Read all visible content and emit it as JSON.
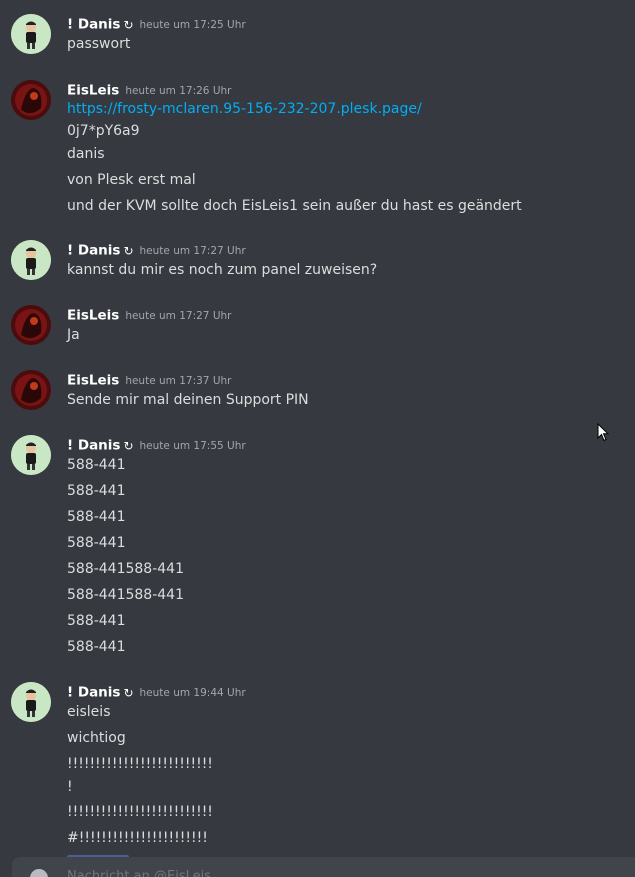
{
  "users": {
    "danis": {
      "name": "! Danis",
      "status_icon": "refresh-icon"
    },
    "eis": {
      "name": "EisLeis"
    }
  },
  "messages": [
    {
      "author": "! Danis",
      "time": "heute um 17:25 Uhr",
      "lines": [
        "passwort"
      ]
    },
    {
      "author": "EisLeis",
      "time": "heute um 17:26 Uhr",
      "link": "https://frosty-mclaren.95-156-232-207.plesk.page/",
      "lines": [
        "0j7*pY6a9",
        "danis",
        "von Plesk erst mal",
        "und der KVM sollte doch EisLeis1 sein außer du hast es geändert"
      ]
    },
    {
      "author": "! Danis",
      "time": "heute um 17:27 Uhr",
      "lines": [
        "kannst du mir es noch zum panel zuweisen?"
      ]
    },
    {
      "author": "EisLeis",
      "time": "heute um 17:27 Uhr",
      "lines": [
        "Ja"
      ]
    },
    {
      "author": "EisLeis",
      "time": "heute um 17:37 Uhr",
      "lines": [
        "Sende mir mal deinen Support PIN"
      ]
    },
    {
      "author": "! Danis",
      "time": "heute um 17:55 Uhr",
      "lines": [
        "588-441",
        "588-441",
        "588-441",
        "588-441",
        "588-441588-441",
        "588-441588-441",
        "588-441",
        "588-441"
      ]
    },
    {
      "author": "! Danis",
      "time": "heute um 19:44 Uhr",
      "lines": [
        "eisleis",
        "wichtiog",
        "!!!!!!!!!!!!!!!!!!!!!!!!!!",
        "!",
        "!!!!!!!!!!!!!!!!!!!!!!!!!!",
        "#!!!!!!!!!!!!!!!!!!!!!!!"
      ]
    }
  ],
  "composer": {
    "placeholder": "Nachricht an @EisLeis"
  },
  "colors": {
    "background": "#36393f",
    "link": "#00aff4",
    "username": "#ffffff",
    "timestamp": "#a3a6aa",
    "text": "#dcddde"
  }
}
